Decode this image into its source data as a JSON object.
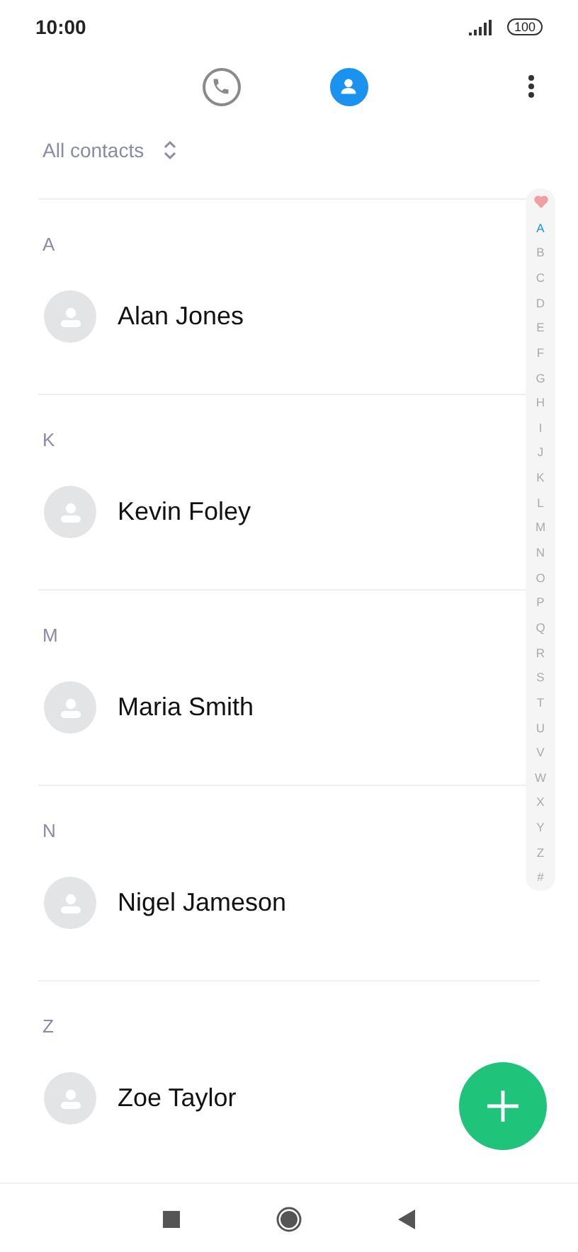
{
  "status_bar": {
    "time": "10:00",
    "battery": "100"
  },
  "tabs": [
    {
      "kind": "phone",
      "selected": false
    },
    {
      "kind": "contacts",
      "selected": true
    }
  ],
  "filter": {
    "label": "All contacts"
  },
  "sections": [
    {
      "letter": "A",
      "contacts": [
        {
          "name": "Alan Jones"
        }
      ]
    },
    {
      "letter": "K",
      "contacts": [
        {
          "name": "Kevin Foley"
        }
      ]
    },
    {
      "letter": "M",
      "contacts": [
        {
          "name": "Maria Smith"
        }
      ]
    },
    {
      "letter": "N",
      "contacts": [
        {
          "name": "Nigel Jameson"
        }
      ]
    },
    {
      "letter": "Z",
      "contacts": [
        {
          "name": "Zoe Taylor"
        }
      ]
    }
  ],
  "index": [
    {
      "letter": "A",
      "selected": true
    },
    {
      "letter": "B",
      "selected": false
    },
    {
      "letter": "C",
      "selected": false
    },
    {
      "letter": "D",
      "selected": false
    },
    {
      "letter": "E",
      "selected": false
    },
    {
      "letter": "F",
      "selected": false
    },
    {
      "letter": "G",
      "selected": false
    },
    {
      "letter": "H",
      "selected": false
    },
    {
      "letter": "I",
      "selected": false
    },
    {
      "letter": "J",
      "selected": false
    },
    {
      "letter": "K",
      "selected": false
    },
    {
      "letter": "L",
      "selected": false
    },
    {
      "letter": "M",
      "selected": false
    },
    {
      "letter": "N",
      "selected": false
    },
    {
      "letter": "O",
      "selected": false
    },
    {
      "letter": "P",
      "selected": false
    },
    {
      "letter": "Q",
      "selected": false
    },
    {
      "letter": "R",
      "selected": false
    },
    {
      "letter": "S",
      "selected": false
    },
    {
      "letter": "T",
      "selected": false
    },
    {
      "letter": "U",
      "selected": false
    },
    {
      "letter": "V",
      "selected": false
    },
    {
      "letter": "W",
      "selected": false
    },
    {
      "letter": "X",
      "selected": false
    },
    {
      "letter": "Y",
      "selected": false
    },
    {
      "letter": "Z",
      "selected": false
    },
    {
      "letter": "#",
      "selected": false
    }
  ]
}
